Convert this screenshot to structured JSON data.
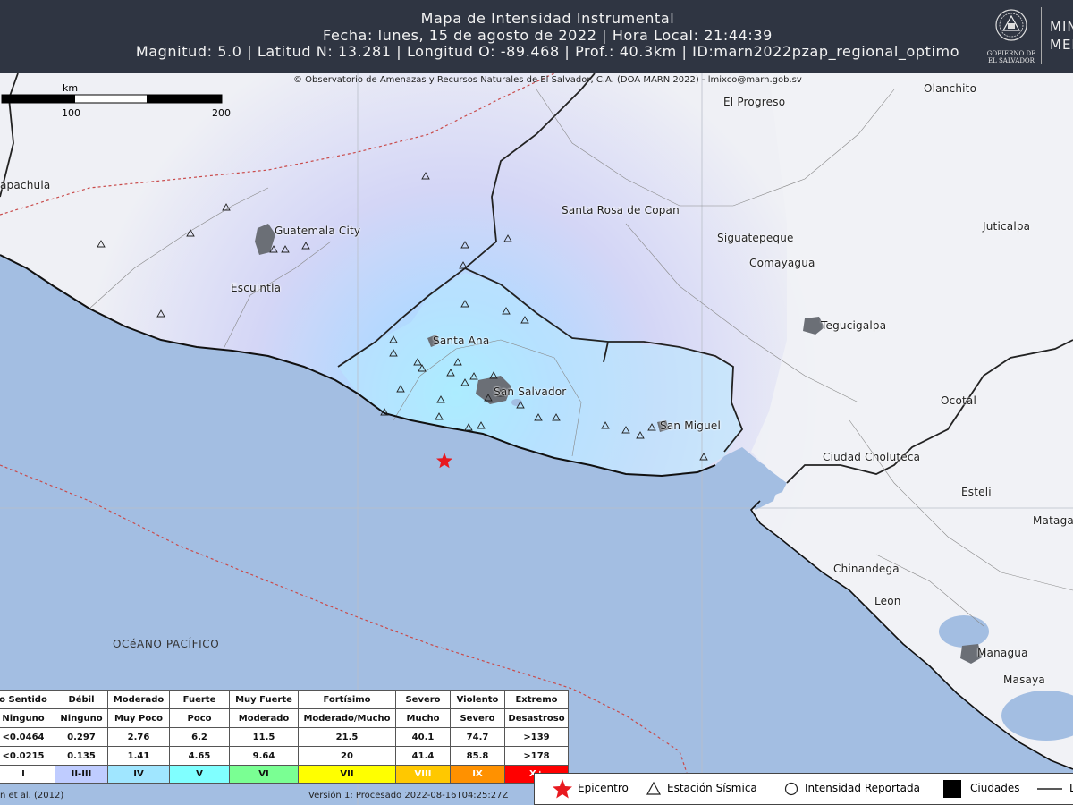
{
  "header": {
    "title": "Mapa de Intensidad Instrumental",
    "date_line": "Fecha: lunes, 15 de agosto de 2022 | Hora Local: 21:44:39",
    "params_line": "Magnitud: 5.0 | Latitud N: 13.281 | Longitud O: -89.468 | Prof.: 40.3km | ID:marn2022pzap_regional_optimo",
    "ministry_text_1": "MIN",
    "ministry_text_2": "MED",
    "seal_text_1": "GOBIERNO DE",
    "seal_text_2": "EL SALVADOR"
  },
  "credit": "© Observatorio de Amenazas y Recursos Naturales de El Salvador, C.A. (DOA MARN 2022) - lmixco@marn.gob.sv",
  "scale_bar": {
    "unit": "km",
    "mark_100": "100",
    "mark_200": "200"
  },
  "places": {
    "tapachula": "apachula",
    "guatemala_city": "Guatemala City",
    "escuintla": "Escuintla",
    "santa_ana": "Santa Ana",
    "san_salvador": "San Salvador",
    "san_miguel": "San Miguel",
    "santa_rosa": "Santa Rosa de Copan",
    "el_progreso": "El Progreso",
    "olanchito": "Olanchito",
    "juticalpa": "Juticalpa",
    "siguatepeque": "Siguatepeque",
    "comayagua": "Comayagua",
    "tegucigalpa": "Tegucigalpa",
    "ocotal": "Ocotal",
    "ciudad_choluteca": "Ciudad Choluteca",
    "esteli": "Esteli",
    "matagalpa": "Mataga",
    "chinandega": "Chinandega",
    "leon": "Leon",
    "managua": "Managua",
    "masaya": "Masaya"
  },
  "ocean": "OCéANO PACÍFICO",
  "intensity_table": {
    "rows": [
      [
        "o Sentido",
        "Débil",
        "Moderado",
        "Fuerte",
        "Muy Fuerte",
        "Fortísimo",
        "Severo",
        "Violento",
        "Extremo"
      ],
      [
        "Ninguno",
        "Ninguno",
        "Muy Poco",
        "Poco",
        "Moderado",
        "Moderado/Mucho",
        "Mucho",
        "Severo",
        "Desastroso"
      ],
      [
        "<0.0464",
        "0.297",
        "2.76",
        "6.2",
        "11.5",
        "21.5",
        "40.1",
        "74.7",
        ">139"
      ],
      [
        "<0.0215",
        "0.135",
        "1.41",
        "4.65",
        "9.64",
        "20",
        "41.4",
        "85.8",
        ">178"
      ]
    ],
    "scale": [
      "I",
      "II-III",
      "IV",
      "V",
      "VI",
      "VII",
      "VIII",
      "IX",
      "X+"
    ],
    "colors": [
      "#ffffff",
      "#bfccff",
      "#a0e6ff",
      "#80ffff",
      "#7aff93",
      "#ffff00",
      "#ffc800",
      "#ff9100",
      "#ff0000"
    ]
  },
  "reference": "n et al. (2012)",
  "version": "Versión 1: Procesado 2022-08-16T04:25:27Z",
  "symbol_legend": {
    "epicenter": "Epicentro",
    "station": "Estación Sísmica",
    "reported": "Intensidad Reportada",
    "cities": "Ciudades",
    "line": "L"
  },
  "colors": {
    "ocean": "#a3bee2",
    "land": "#f4f5f7",
    "epicenter": "#e8191f",
    "header_bg": "#2f3542"
  }
}
